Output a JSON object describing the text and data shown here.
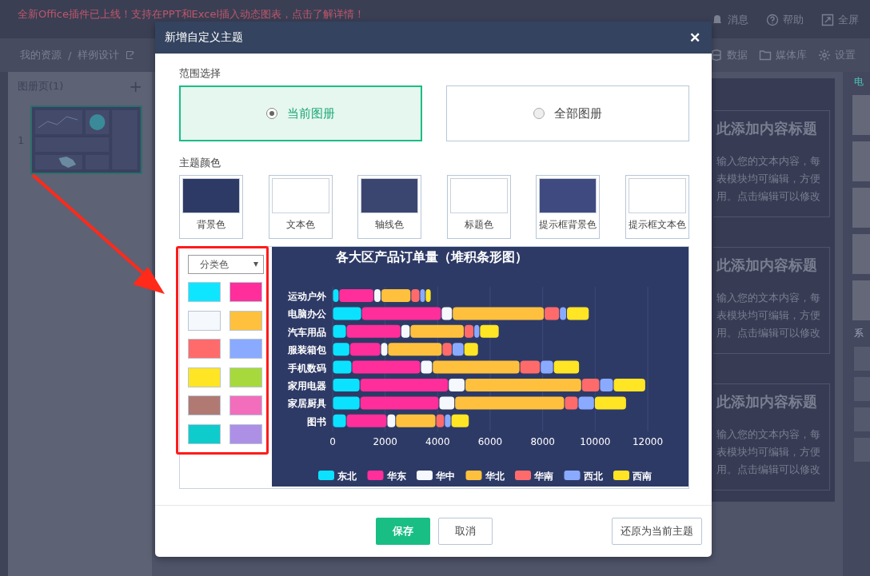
{
  "top_bar": {
    "banner": "全新Office插件已上线！支持在PPT和Excel插入动态图表，点击了解详情！",
    "actions": [
      {
        "kind": "bell",
        "label": "消息"
      },
      {
        "kind": "help",
        "label": "帮助"
      },
      {
        "kind": "fullscreen",
        "label": "全屏"
      }
    ]
  },
  "toolbar": {
    "breadcrumb": [
      "我的资源",
      "/",
      "样例设计"
    ],
    "tools": [
      {
        "kind": "data",
        "label": "数据"
      },
      {
        "kind": "media",
        "label": "媒体库"
      },
      {
        "kind": "gear",
        "label": "设置"
      }
    ]
  },
  "pages_panel": {
    "title": "图册页(1)",
    "add": "+",
    "pages": [
      {
        "number": "1",
        "selected": true
      }
    ]
  },
  "canvas_cards": [
    {
      "title": "此添加内容标题",
      "lines": [
        "输入您的文本内容，每",
        "表模块均可编辑，方便",
        "用。点击编辑可以修改"
      ]
    },
    {
      "title": "此添加内容标题",
      "lines": [
        "输入您的文本内容，每",
        "表模块均可编辑，方便",
        "用。点击编辑可以修改"
      ]
    },
    {
      "title": "此添加内容标题",
      "lines": [
        "输入您的文本内容，每",
        "表模块均可编辑，方便",
        "用。点击编辑可以修改"
      ]
    }
  ],
  "right_panel": {
    "tab": "电",
    "section": "系"
  },
  "dialog": {
    "title": "新增自定义主题",
    "close": "✕",
    "scope_label": "范围选择",
    "scopes": [
      {
        "label": "当前图册",
        "selected": true
      },
      {
        "label": "全部图册",
        "selected": false
      }
    ],
    "colors_label": "主题颜色",
    "theme_colors": [
      {
        "label": "背景色",
        "color": "#2e3a66"
      },
      {
        "label": "文本色",
        "color": "#ffffff"
      },
      {
        "label": "轴线色",
        "color": "#3b4670"
      },
      {
        "label": "标题色",
        "color": "#ffffff"
      },
      {
        "label": "提示框背景色",
        "color": "#3f4b80"
      },
      {
        "label": "提示框文本色",
        "color": "#ffffff"
      }
    ],
    "palette_select": "分类色",
    "palette": [
      {
        "color": "#0ee6ff"
      },
      {
        "color": "#ff2e9a"
      },
      {
        "color": "#f5f8fc"
      },
      {
        "color": "#ffc13d"
      },
      {
        "color": "#ff6b6b"
      },
      {
        "color": "#8aaaff"
      },
      {
        "color": "#ffe524"
      },
      {
        "color": "#a8d93c"
      },
      {
        "color": "#b07a72"
      },
      {
        "color": "#f26ebd"
      },
      {
        "color": "#0ecccc"
      },
      {
        "color": "#ad8fe6"
      }
    ],
    "chart_data": {
      "type": "bar",
      "orientation": "horizontal",
      "stacked": true,
      "title": "各大区产品订单量（堆积条形图）",
      "categories": [
        "运动户外",
        "电脑办公",
        "汽车用品",
        "服装箱包",
        "手机数码",
        "家用电器",
        "家居厨具",
        "图书"
      ],
      "xlim": [
        0,
        12000
      ],
      "grid": true,
      "legend": true,
      "xticks": [
        0,
        2000,
        4000,
        6000,
        8000,
        10000,
        12000
      ],
      "series": [
        {
          "name": "东北",
          "color": "#0be2ff",
          "values": [
            240,
            1100,
            520,
            650,
            730,
            1040,
            1040,
            520
          ]
        },
        {
          "name": "华东",
          "color": "#ff2e9a",
          "values": [
            1330,
            3040,
            2080,
            1180,
            2620,
            3370,
            3010,
            1550
          ]
        },
        {
          "name": "华中",
          "color": "#f5f8fc",
          "values": [
            270,
            420,
            350,
            270,
            450,
            630,
            600,
            330
          ]
        },
        {
          "name": "华北",
          "color": "#ffc13d",
          "values": [
            1140,
            3500,
            2060,
            2070,
            3330,
            4440,
            4180,
            1530
          ]
        },
        {
          "name": "华南",
          "color": "#ff6b6b",
          "values": [
            340,
            580,
            370,
            380,
            780,
            690,
            520,
            330
          ]
        },
        {
          "name": "西北",
          "color": "#8aaaff",
          "values": [
            210,
            270,
            220,
            450,
            500,
            520,
            620,
            250
          ]
        },
        {
          "name": "西南",
          "color": "#ffe524",
          "values": [
            220,
            860,
            740,
            550,
            990,
            1230,
            1220,
            690
          ]
        }
      ]
    },
    "buttons": [
      {
        "kind": "primary",
        "label": "保存"
      },
      {
        "kind": "secondary",
        "label": "取消"
      },
      {
        "kind": "reset",
        "label": "还原为当前主题"
      }
    ]
  }
}
